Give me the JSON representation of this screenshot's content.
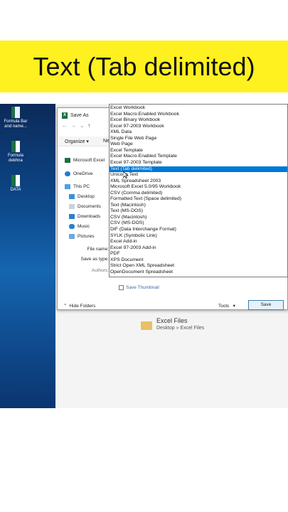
{
  "banner": {
    "title": "Text (Tab delimited)"
  },
  "desktop": {
    "icons": [
      {
        "label": "Formula Bar and name..."
      },
      {
        "label": "Formula dekhna"
      },
      {
        "label": "DATA"
      }
    ]
  },
  "dialog": {
    "title": "Save As",
    "toolbar": {
      "organize": "Organize ▾",
      "new_folder": "Ne"
    },
    "nav": [
      {
        "label": "Microsoft Excel"
      },
      {
        "label": "OneDrive"
      },
      {
        "label": "This PC"
      },
      {
        "label": "Desktop"
      },
      {
        "label": "Documents"
      },
      {
        "label": "Downloads"
      },
      {
        "label": "Music"
      },
      {
        "label": "Pictures"
      }
    ],
    "file_name_label": "File name:",
    "save_as_type_label": "Save as type:",
    "authors_label": "Authors:",
    "save_thumbnail": "Save Thumbnail",
    "hide_folders": "Hide Folders",
    "tools": "Tools",
    "save": "Save"
  },
  "file_types": [
    "Excel Workbook",
    "Excel Macro-Enabled Workbook",
    "Excel Binary Workbook",
    "Excel 97-2003 Workbook",
    "XML Data",
    "Single File Web Page",
    "Web Page",
    "Excel Template",
    "Excel Macro-Enabled Template",
    "Excel 97-2003 Template",
    "Text (Tab delimited)",
    "Unicode Text",
    "XML Spreadsheet 2003",
    "Microsoft Excel 5.0/95 Workbook",
    "CSV (Comma delimited)",
    "Formatted Text (Space delimited)",
    "Text (Macintosh)",
    "Text (MS-DOS)",
    "CSV (Macintosh)",
    "CSV (MS-DOS)",
    "DIF (Data Interchange Format)",
    "SYLK (Symbolic Link)",
    "Excel Add-in",
    "Excel 97-2003 Add-in",
    "PDF",
    "XPS Document",
    "Strict Open XML Spreadsheet",
    "OpenDocument Spreadsheet"
  ],
  "selected_type": "Text (Tab delimited)",
  "recent": {
    "folder_name": "Excel Files",
    "folder_path": "Desktop » Excel Files"
  },
  "colors": {
    "banner": "#fff01f",
    "selection": "#0078d7",
    "excel_green": "#1d7044"
  }
}
